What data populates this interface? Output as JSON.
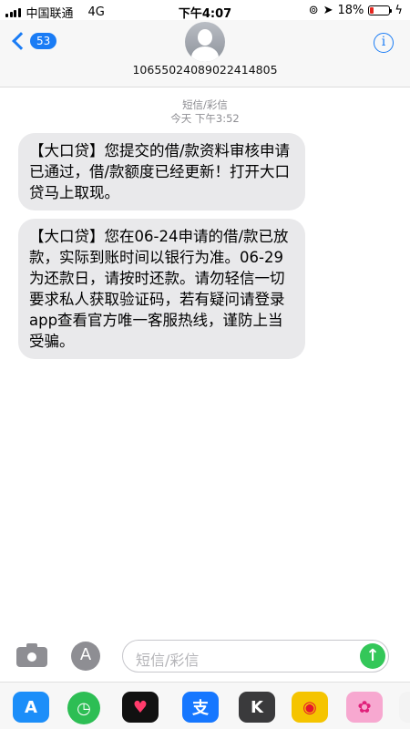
{
  "status_bar": {
    "carrier": "中国联通",
    "network": "4G",
    "time": "下午4:07",
    "battery_percent": "18%",
    "battery_level": 0.18
  },
  "header": {
    "back_badge": "53",
    "contact": "10655024089022414805",
    "info_glyph": "i"
  },
  "conversation": {
    "service_label": "短信/彩信",
    "timestamp": "今天 下午3:52",
    "messages": [
      {
        "text": "【大口贷】您提交的借/款资料审核申请已通过，借/款额度已经更新！打开大口贷马上取现。"
      },
      {
        "text": "【大口贷】您在06-24申请的借/款已放款，实际到账时间以银行为准。06-29为还款日，请按时还款。请勿轻信一切要求私人获取验证码，若有疑问请登录app查看官方唯一客服热线，谨防上当受骗。"
      }
    ]
  },
  "input": {
    "placeholder": "短信/彩信",
    "apps_glyph": "A",
    "send_glyph": "↑"
  },
  "app_strip": {
    "items": [
      {
        "icon": "app-store-icon",
        "glyph": "A"
      },
      {
        "icon": "clock-icon",
        "glyph": "◷"
      },
      {
        "icon": "heart-icon",
        "glyph": "♥"
      },
      {
        "icon": "alipay-icon",
        "glyph": "支"
      },
      {
        "icon": "k-app-icon",
        "glyph": "K"
      },
      {
        "icon": "weibo-icon",
        "glyph": "◉"
      },
      {
        "icon": "sticker-icon",
        "glyph": "✿"
      },
      {
        "icon": "more-icon",
        "glyph": ""
      }
    ]
  }
}
